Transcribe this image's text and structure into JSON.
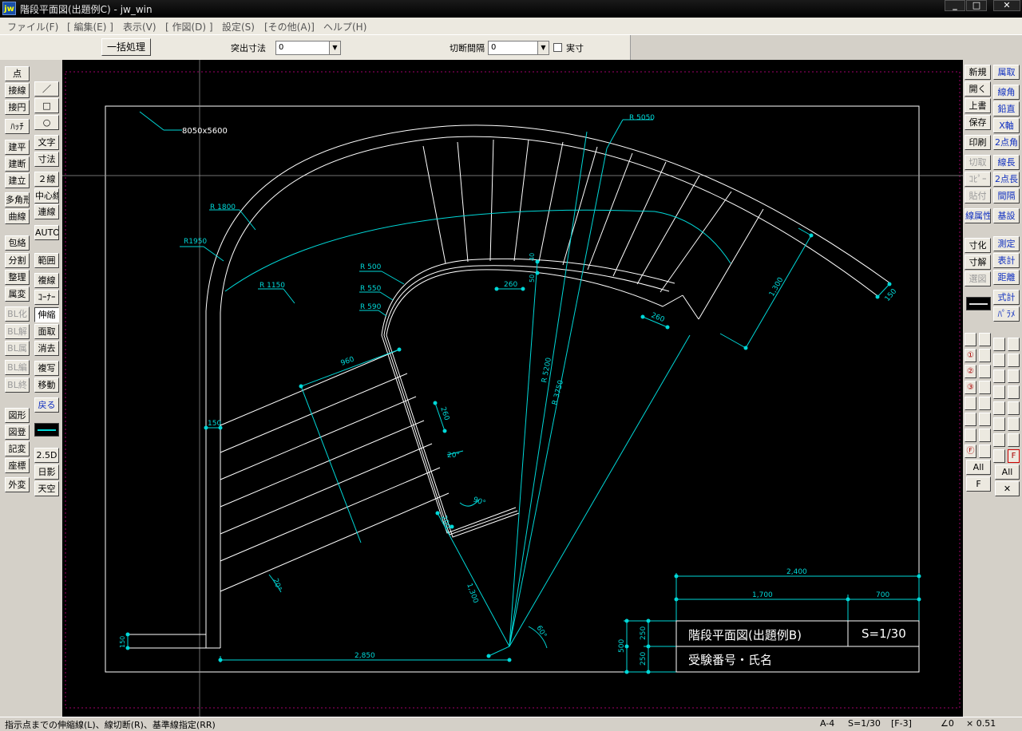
{
  "window": {
    "app_logo": "jw",
    "title": "階段平面図(出題例C) - jw_win",
    "controls": [
      "minimize-icon",
      "maximize-icon",
      "close-icon"
    ]
  },
  "menu": [
    "ファイル(F)",
    "[ 編集(E) ]",
    "表示(V)",
    "[ 作図(D) ]",
    "設定(S)",
    "[その他(A)]",
    "ヘルプ(H)"
  ],
  "toolbar": {
    "batch_button": "一括処理",
    "protrude_label": "突出寸法",
    "protrude_value": "0",
    "cut_gap_label": "切断間隔",
    "cut_gap_value": "0",
    "actual_label": "実寸"
  },
  "left_tools": [
    [
      "点"
    ],
    [
      "接線"
    ],
    [
      "接円"
    ],
    [
      "ﾊｯﾁ"
    ],
    [
      "建平"
    ],
    [
      "建断"
    ],
    [
      "建立"
    ],
    [
      "多角形"
    ],
    [
      "曲線"
    ],
    [
      "包絡"
    ],
    [
      "分割"
    ],
    [
      "整理"
    ],
    [
      "属変"
    ],
    [
      "BL化"
    ],
    [
      "BL解"
    ],
    [
      "BL属"
    ],
    [
      "BL編"
    ],
    [
      "BL終"
    ],
    [
      "図形"
    ],
    [
      "図登"
    ],
    [
      "記変"
    ],
    [
      "座標"
    ],
    [
      "外変"
    ]
  ],
  "left_tools2": [
    "文字",
    "寸法",
    "２線",
    "中心線",
    "連線",
    "AUTO",
    "範囲",
    "複線",
    "ｺｰﾅｰ",
    "伸縮",
    "面取",
    "消去",
    "複写",
    "移動",
    "戻る",
    "2.5D",
    "日影",
    "天空"
  ],
  "right_tools": [
    "新規",
    "開く",
    "上書",
    "保存",
    "印刷",
    "切取",
    "ｺﾋﾟｰ",
    "貼付",
    "線属性",
    "寸化",
    "寸解",
    "選図"
  ],
  "right_tools2": [
    "属取",
    "線角",
    "鉛直",
    "X軸",
    "2点角",
    "線長",
    "2点長",
    "間隔",
    "基設",
    "測定",
    "表計",
    "距離",
    "式計",
    "ﾊﾟﾗﾒ"
  ],
  "layer_buttons": {
    "all": "All",
    "f": "F",
    "x": "✕",
    "nums": [
      "①",
      "②",
      "③",
      "Ⓕ",
      "F"
    ]
  },
  "drawing": {
    "paper_size": "8050x5600",
    "radius_labels": [
      "R 5050",
      "R 1800",
      "R1950",
      "R 1150",
      "R 500",
      "R 550",
      "R 590",
      "R 5200",
      "R 3750"
    ],
    "dims": [
      "1,300",
      "260",
      "260",
      "150",
      "40",
      "50",
      "960",
      "150",
      "260",
      "20°",
      "90°",
      "200",
      "1,300",
      "20°",
      "60°",
      "2,850",
      "150",
      "2,400",
      "1,700",
      "700",
      "500",
      "250",
      "250"
    ],
    "title_block": {
      "title": "階段平面図(出題例B)",
      "scale": "S=1/30",
      "name": "受験番号・氏名"
    }
  },
  "status": {
    "message": "指示点までの伸縮線(L)、線切断(R)、基準線指定(RR)",
    "paper": "A-4",
    "scale": "S=1/30",
    "layer": "[F-3]",
    "angle": "∠0",
    "zoom": "× 0.51"
  }
}
